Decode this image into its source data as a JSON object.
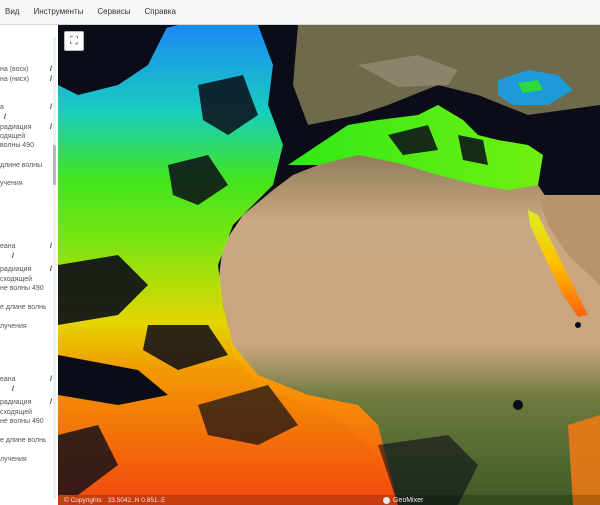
{
  "menu": [
    "Вид",
    "Инструменты",
    "Сервисы",
    "Справка"
  ],
  "sidebar": {
    "groups": [
      {
        "items": [
          {
            "label": "на (воск)",
            "suffix": "/"
          },
          {
            "label": "на (нисх)",
            "suffix": "/"
          },
          {
            "label": "а",
            "suffix": "/"
          },
          {
            "label": "",
            "suffix": "/"
          },
          {
            "label": "радиация",
            "suffix": "/"
          },
          {
            "label": "одящей",
            "suffix": ""
          },
          {
            "label": "волны 490",
            "suffix": ""
          },
          {
            "label": "длине волны",
            "suffix": ""
          },
          {
            "label": "учения",
            "suffix": ""
          }
        ]
      },
      {
        "items": [
          {
            "label": "еана",
            "suffix": "/"
          },
          {
            "label": "",
            "suffix": "/"
          },
          {
            "label": "радиация",
            "suffix": "/"
          },
          {
            "label": "сходящей",
            "suffix": ""
          },
          {
            "label": "не волны 490",
            "suffix": ""
          },
          {
            "label": "е длине волны",
            "suffix": ""
          },
          {
            "label": "лучения",
            "suffix": ""
          }
        ]
      },
      {
        "items": [
          {
            "label": "еана",
            "suffix": "/"
          },
          {
            "label": "",
            "suffix": "/"
          },
          {
            "label": "радиация",
            "suffix": "/"
          },
          {
            "label": "сходящей",
            "suffix": ""
          },
          {
            "label": "не волны 490",
            "suffix": ""
          },
          {
            "label": "е длине волны",
            "suffix": ""
          },
          {
            "label": "лучения",
            "suffix": ""
          }
        ]
      }
    ]
  },
  "map": {
    "expand_icon": "⛶",
    "status": {
      "copyright": "© Copyrights",
      "coords": "33.5042..N 0.851..E",
      "logo": "GeoMixer"
    },
    "colors": {
      "ocean": "#0a0c18",
      "sahara": "#c9a883",
      "vegetation": "#4e6b2f",
      "mountains": "#7a6a4e"
    }
  }
}
